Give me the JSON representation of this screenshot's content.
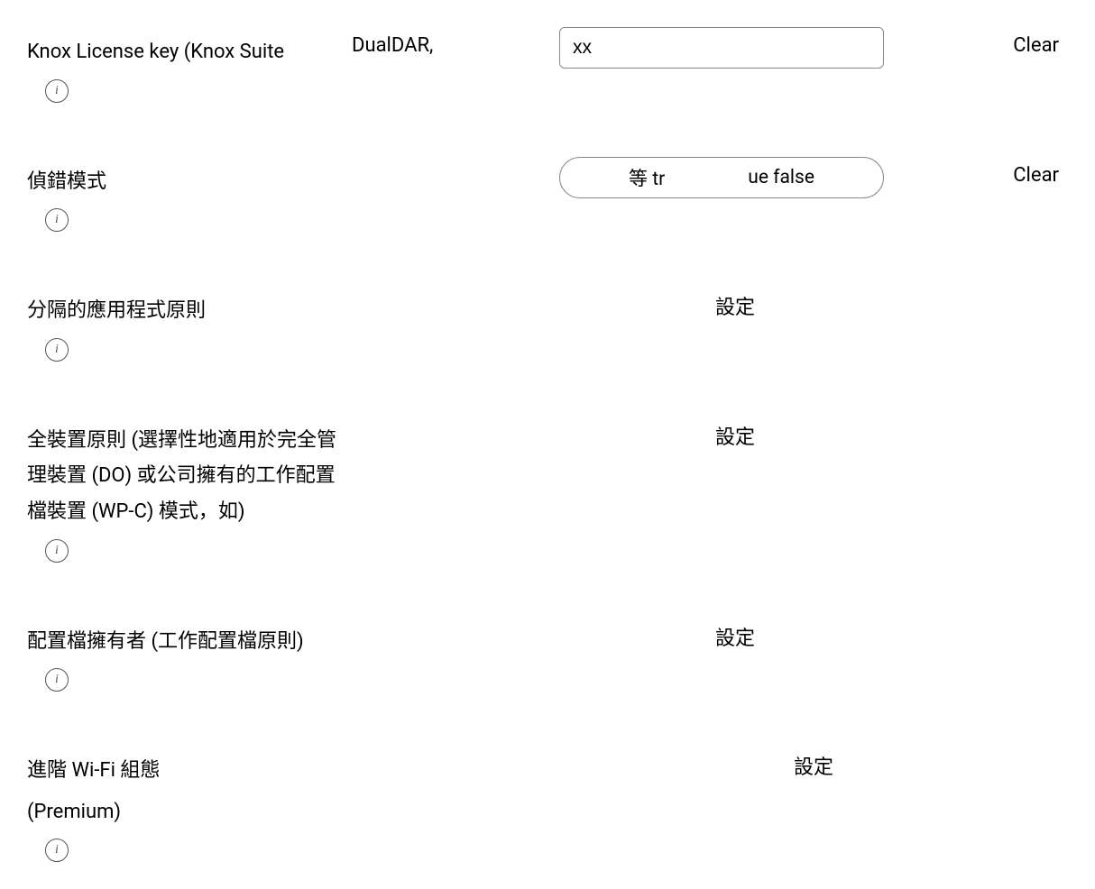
{
  "rows": {
    "knox_license": {
      "label": "Knox License key (Knox Suite",
      "hint": "DualDAR,",
      "input_value": "xx",
      "action": "Clear"
    },
    "debug_mode": {
      "label": "偵錯模式",
      "pill_left": "等 tr",
      "pill_right": "ue false",
      "action": "Clear"
    },
    "separated_apps": {
      "label": "分隔的應用程式原則",
      "control": "設定"
    },
    "device_wide": {
      "label": "全裝置原則 (選擇性地適用於完全管理裝置 (DO) 或公司擁有的工作配置檔裝置 (WP-C) 模式，如)",
      "control": "設定"
    },
    "profile_owner": {
      "label": "配置檔擁有者 (工作配置檔原則)",
      "control": "設定"
    },
    "advanced_wifi": {
      "label_line1": "進階 Wi-Fi 組態",
      "label_line2": "(Premium)",
      "control": "設定"
    }
  }
}
